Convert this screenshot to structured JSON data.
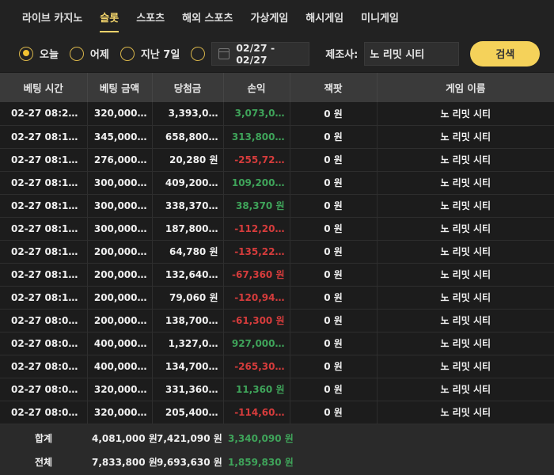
{
  "tabs": [
    {
      "label": "라이브 카지노",
      "active": false
    },
    {
      "label": "슬롯",
      "active": true
    },
    {
      "label": "스포츠",
      "active": false
    },
    {
      "label": "해외 스포츠",
      "active": false
    },
    {
      "label": "가상게임",
      "active": false
    },
    {
      "label": "해시게임",
      "active": false
    },
    {
      "label": "미니게임",
      "active": false
    }
  ],
  "filters": {
    "radios": [
      {
        "label": "오늘",
        "checked": true
      },
      {
        "label": "어제",
        "checked": false
      },
      {
        "label": "지난 7일",
        "checked": false
      }
    ],
    "date_range": "02/27 - 02/27",
    "maker_label": "제조사:",
    "maker_value": "노 리밋 시티",
    "search_label": "검색"
  },
  "table": {
    "headers": [
      "베팅 시간",
      "베팅 금액",
      "당첨금",
      "손익",
      "잭팟",
      "게임 이름"
    ],
    "rows": [
      {
        "time": "02-27 08:20:…",
        "bet": "320,000…",
        "win": "3,393,0…",
        "pl": "3,073,0…",
        "pl_sign": "pos",
        "jackpot": "0 원",
        "game": "노 리밋 시티"
      },
      {
        "time": "02-27 08:18:…",
        "bet": "345,000…",
        "win": "658,800…",
        "pl": "313,800…",
        "pl_sign": "pos",
        "jackpot": "0 원",
        "game": "노 리밋 시티"
      },
      {
        "time": "02-27 08:17:…",
        "bet": "276,000…",
        "win": "20,280 원",
        "pl": "-255,72…",
        "pl_sign": "neg",
        "jackpot": "0 원",
        "game": "노 리밋 시티"
      },
      {
        "time": "02-27 08:16:…",
        "bet": "300,000…",
        "win": "409,200…",
        "pl": "109,200…",
        "pl_sign": "pos",
        "jackpot": "0 원",
        "game": "노 리밋 시티"
      },
      {
        "time": "02-27 08:14:…",
        "bet": "300,000…",
        "win": "338,370…",
        "pl": "38,370 원",
        "pl_sign": "pos",
        "jackpot": "0 원",
        "game": "노 리밋 시티"
      },
      {
        "time": "02-27 08:13:…",
        "bet": "300,000…",
        "win": "187,800…",
        "pl": "-112,20…",
        "pl_sign": "neg",
        "jackpot": "0 원",
        "game": "노 리밋 시티"
      },
      {
        "time": "02-27 08:13:…",
        "bet": "200,000…",
        "win": "64,780 원",
        "pl": "-135,22…",
        "pl_sign": "neg",
        "jackpot": "0 원",
        "game": "노 리밋 시티"
      },
      {
        "time": "02-27 08:11:…",
        "bet": "200,000…",
        "win": "132,640…",
        "pl": "-67,360 원",
        "pl_sign": "neg",
        "jackpot": "0 원",
        "game": "노 리밋 시티"
      },
      {
        "time": "02-27 08:10:…",
        "bet": "200,000…",
        "win": "79,060 원",
        "pl": "-120,94…",
        "pl_sign": "neg",
        "jackpot": "0 원",
        "game": "노 리밋 시티"
      },
      {
        "time": "02-27 08:09:…",
        "bet": "200,000…",
        "win": "138,700…",
        "pl": "-61,300 원",
        "pl_sign": "neg",
        "jackpot": "0 원",
        "game": "노 리밋 시티"
      },
      {
        "time": "02-27 08:06:…",
        "bet": "400,000…",
        "win": "1,327,0…",
        "pl": "927,000…",
        "pl_sign": "pos",
        "jackpot": "0 원",
        "game": "노 리밋 시티"
      },
      {
        "time": "02-27 08:05:…",
        "bet": "400,000…",
        "win": "134,700…",
        "pl": "-265,30…",
        "pl_sign": "neg",
        "jackpot": "0 원",
        "game": "노 리밋 시티"
      },
      {
        "time": "02-27 08:02:…",
        "bet": "320,000…",
        "win": "331,360…",
        "pl": "11,360 원",
        "pl_sign": "pos",
        "jackpot": "0 원",
        "game": "노 리밋 시티"
      },
      {
        "time": "02-27 08:01:…",
        "bet": "320,000…",
        "win": "205,400…",
        "pl": "-114,60…",
        "pl_sign": "neg",
        "jackpot": "0 원",
        "game": "노 리밋 시티"
      }
    ],
    "summary": {
      "label": "합계",
      "bet": "4,081,000 원",
      "win": "7,421,090 원",
      "pl": "3,340,090 원",
      "pl_sign": "pos"
    },
    "total": {
      "label": "전체",
      "bet": "7,833,800 원",
      "win": "9,693,630 원",
      "pl": "1,859,830 원",
      "pl_sign": "pos"
    }
  },
  "colors": {
    "accent": "#f1d36b",
    "button": "#f5d25a",
    "positive": "#3fa45a",
    "negative": "#d63c3c"
  }
}
